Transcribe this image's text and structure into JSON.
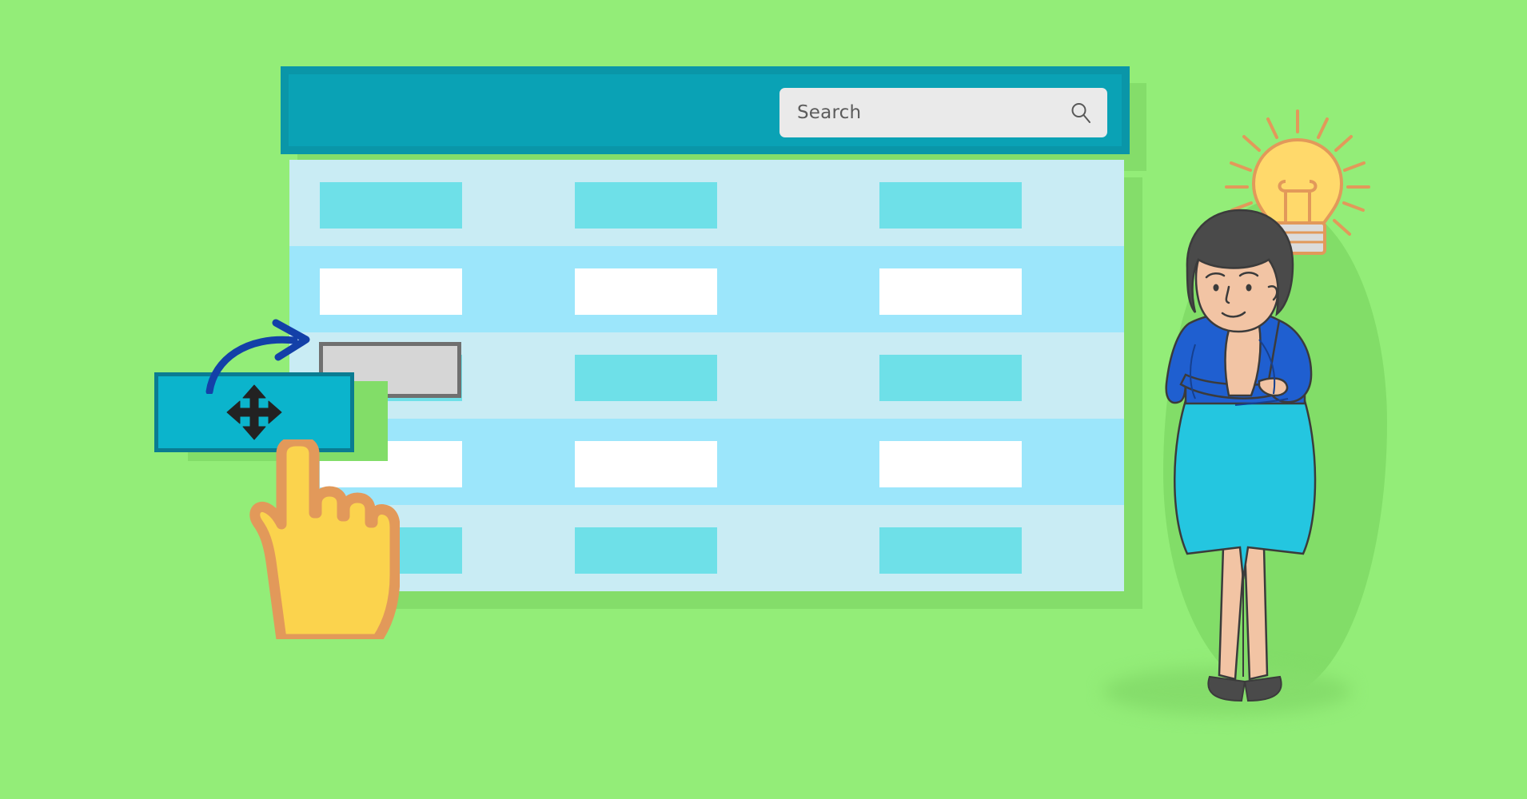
{
  "page": {
    "background_color": "#93ed78",
    "shadow_color": "#84dd6a"
  },
  "app_window": {
    "header": {
      "name": "app-header-bar",
      "background_color": "#0aa2b5",
      "border_color": "#0a96a8"
    },
    "search": {
      "placeholder": "Search",
      "value": "",
      "icon": "search-icon",
      "background_color": "#eaeaea",
      "text_color": "#5c5c5c"
    }
  },
  "table": {
    "name": "data-table",
    "row_color_odd": "#c9ecf4",
    "row_color_even": "#9ce6fb",
    "chip_color_teal": "#6ee0e8",
    "chip_color_white": "#ffffff",
    "columns": 3,
    "rows": [
      {
        "index": 0,
        "stripe": "odd",
        "cells": [
          "teal",
          "teal",
          "teal"
        ]
      },
      {
        "index": 1,
        "stripe": "even",
        "cells": [
          "white",
          "white",
          "white"
        ]
      },
      {
        "index": 2,
        "stripe": "odd",
        "cells": [
          "teal",
          "teal",
          "teal"
        ]
      },
      {
        "index": 3,
        "stripe": "even",
        "cells": [
          "white",
          "white",
          "white"
        ]
      },
      {
        "index": 4,
        "stripe": "odd",
        "cells": [
          "teal",
          "teal",
          "teal"
        ]
      }
    ]
  },
  "drag_drop": {
    "placeholder": {
      "name": "drop-target-placeholder",
      "fill": "#d6d6d6",
      "border": "#707070"
    },
    "dragged_item": {
      "name": "dragged-row-chip",
      "fill": "#0bb4cc",
      "border": "#0a7c92",
      "icon": "move-icon"
    },
    "arrow": {
      "name": "drag-direction-arrow",
      "color": "#1340a8"
    },
    "cursor": {
      "name": "hand-pointer-cursor",
      "fill": "#fbd34d",
      "stroke": "#e2995a"
    }
  },
  "illustration": {
    "woman": {
      "name": "thinking-woman-illustration",
      "hair_color": "#4a4a4a",
      "skin_color": "#f2c4a4",
      "top_color": "#1f5fd0",
      "skirt_color": "#24c6e0",
      "shoe_color": "#4a4a4a"
    },
    "lightbulb": {
      "name": "lightbulb-idea-icon",
      "glass_color": "#ffd96b",
      "outline_color": "#e2995a",
      "base_color": "#d9d9d9"
    },
    "blob": {
      "name": "background-blob",
      "color": "#82dd68"
    }
  }
}
